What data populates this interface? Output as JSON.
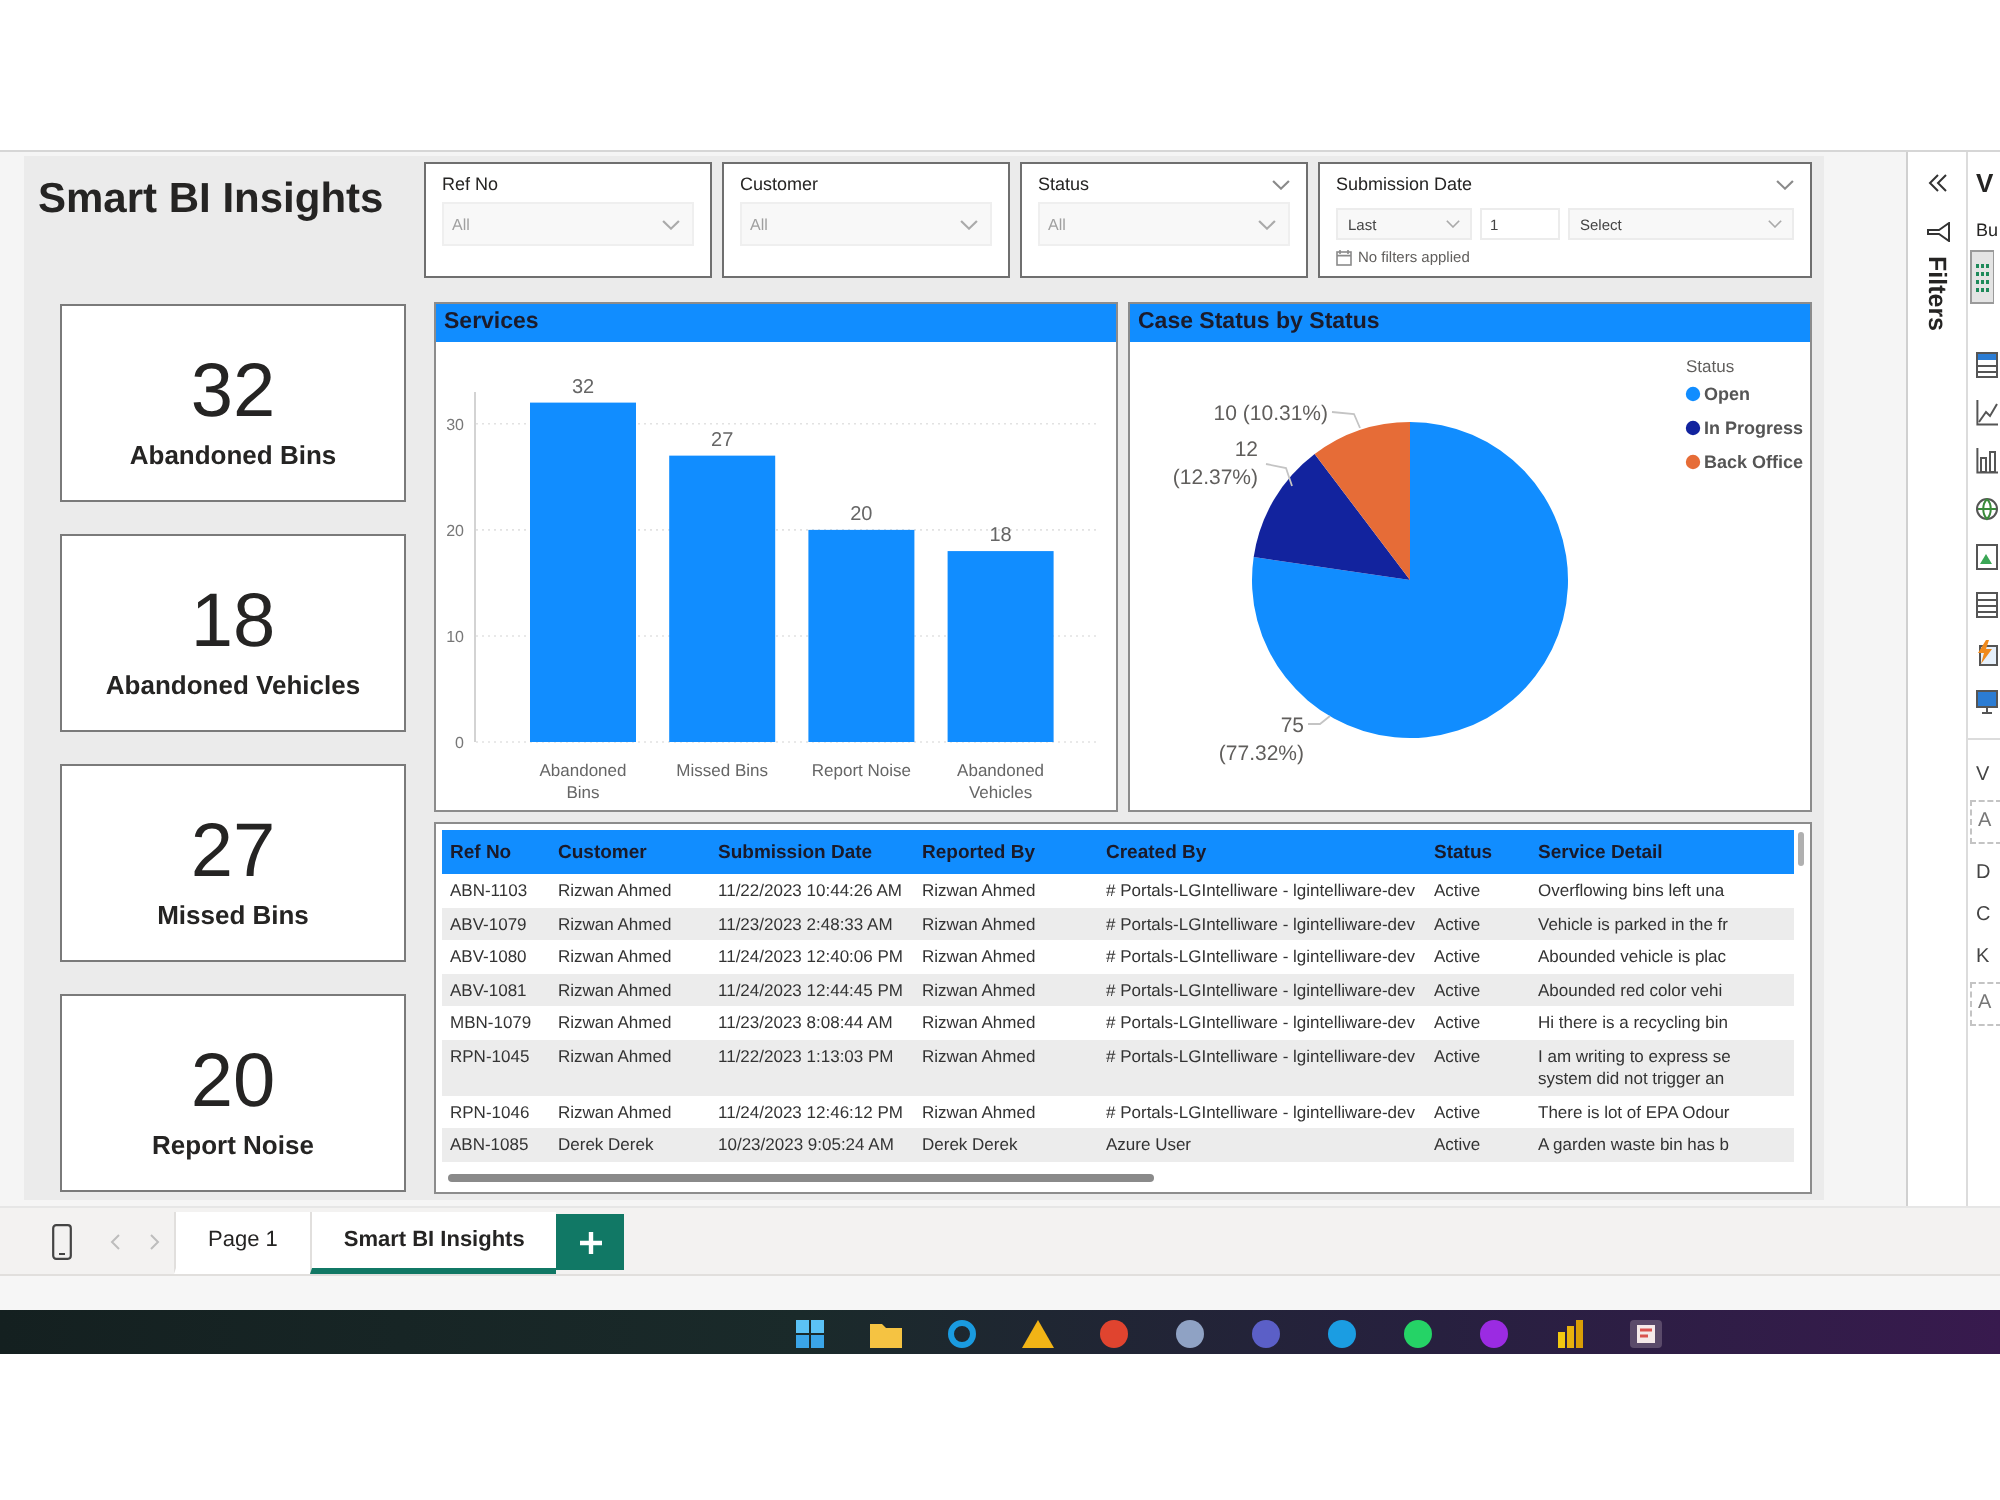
{
  "report_title": "Smart BI Insights",
  "slicers": [
    {
      "kind": "dropdown",
      "title": "Ref No",
      "value": "All",
      "header_chevron": false
    },
    {
      "kind": "dropdown",
      "title": "Customer",
      "value": "All",
      "header_chevron": false
    },
    {
      "kind": "dropdown",
      "title": "Status",
      "value": "All",
      "header_chevron": true
    },
    {
      "kind": "relative_date",
      "title": "Submission Date",
      "header_chevron": true,
      "period": "Last",
      "count": "1",
      "unit": "Select",
      "note": "No filters applied"
    }
  ],
  "kpi_cards": [
    {
      "value": "32",
      "label": "Abandoned Bins"
    },
    {
      "value": "18",
      "label": "Abandoned Vehicles"
    },
    {
      "value": "27",
      "label": "Missed Bins"
    },
    {
      "value": "20",
      "label": "Report Noise"
    }
  ],
  "services_chart": {
    "title": "Services",
    "chart_data": {
      "type": "bar",
      "categories": [
        "Abandoned Bins",
        "Missed Bins",
        "Report Noise",
        "Abandoned Vehicles"
      ],
      "values": [
        32,
        27,
        20,
        18
      ],
      "ylim": [
        0,
        33
      ],
      "yticks": [
        0,
        10,
        20,
        30
      ],
      "grid": true,
      "value_labels": [
        "32",
        "27",
        "20",
        "18"
      ]
    }
  },
  "case_status_chart": {
    "title": "Case Status by Status",
    "chart_data": {
      "type": "pie",
      "categories": [
        "Open",
        "In Progress",
        "Back Office"
      ],
      "values": [
        75,
        12,
        10
      ],
      "value_labels": [
        "75 (77.32%)",
        "12 (12.37%)",
        "10 (10.31%)"
      ],
      "legend": {
        "title": "Status",
        "items": [
          {
            "color": "#118dff"
          },
          {
            "color": "#12239e"
          },
          {
            "color": "#e66c37"
          }
        ]
      }
    }
  },
  "table": {
    "columns": [
      "Ref No",
      "Customer",
      "Submission Date",
      "Reported By",
      "Created By",
      "Status",
      "Service Detail"
    ],
    "rows": [
      [
        "ABN-1103",
        "Rizwan Ahmed",
        "11/22/2023 10:44:26 AM",
        "Rizwan Ahmed",
        "# Portals-LGIntelliware - lgintelliware-dev",
        "Active",
        "Overflowing bins left una"
      ],
      [
        "ABV-1079",
        "Rizwan Ahmed",
        "11/23/2023 2:48:33 AM",
        "Rizwan Ahmed",
        "# Portals-LGIntelliware - lgintelliware-dev",
        "Active",
        "Vehicle is parked in the fr"
      ],
      [
        "ABV-1080",
        "Rizwan Ahmed",
        "11/24/2023 12:40:06 PM",
        "Rizwan Ahmed",
        "# Portals-LGIntelliware - lgintelliware-dev",
        "Active",
        "Abounded vehicle is plac"
      ],
      [
        "ABV-1081",
        "Rizwan Ahmed",
        "11/24/2023 12:44:45 PM",
        "Rizwan Ahmed",
        "# Portals-LGIntelliware - lgintelliware-dev",
        "Active",
        "Abounded red color vehi"
      ],
      [
        "MBN-1079",
        "Rizwan Ahmed",
        "11/23/2023 8:08:44 AM",
        "Rizwan Ahmed",
        "# Portals-LGIntelliware - lgintelliware-dev",
        "Active",
        "Hi there is a recycling bin"
      ],
      [
        "RPN-1045",
        "Rizwan Ahmed",
        "11/22/2023 1:13:03 PM",
        "Rizwan Ahmed",
        "# Portals-LGIntelliware - lgintelliware-dev",
        "Active",
        "I am writing to express se\nsystem did not trigger an"
      ],
      [
        "RPN-1046",
        "Rizwan Ahmed",
        "11/24/2023 12:46:12 PM",
        "Rizwan Ahmed",
        "# Portals-LGIntelliware - lgintelliware-dev",
        "Active",
        "There is lot of EPA Odour"
      ],
      [
        "ABN-1085",
        "Derek Derek",
        "10/23/2023 9:05:24 AM",
        "Derek Derek",
        "Azure User",
        "Active",
        "A garden waste bin has b"
      ]
    ]
  },
  "page_tabs": [
    {
      "label": "Page 1",
      "selected": false
    },
    {
      "label": "Smart BI Insights",
      "selected": true
    }
  ],
  "filters_pane": {
    "label": "Filters"
  },
  "visualizations_pane": {
    "title": "V",
    "tab": "Bu",
    "sections": [
      {
        "kind": "heading",
        "text": "V"
      },
      {
        "kind": "dropzone",
        "text": "A"
      },
      {
        "kind": "heading",
        "text": "D"
      },
      {
        "kind": "heading",
        "text": "C"
      },
      {
        "kind": "heading",
        "text": "K"
      },
      {
        "kind": "dropzone",
        "text": "A"
      }
    ]
  }
}
